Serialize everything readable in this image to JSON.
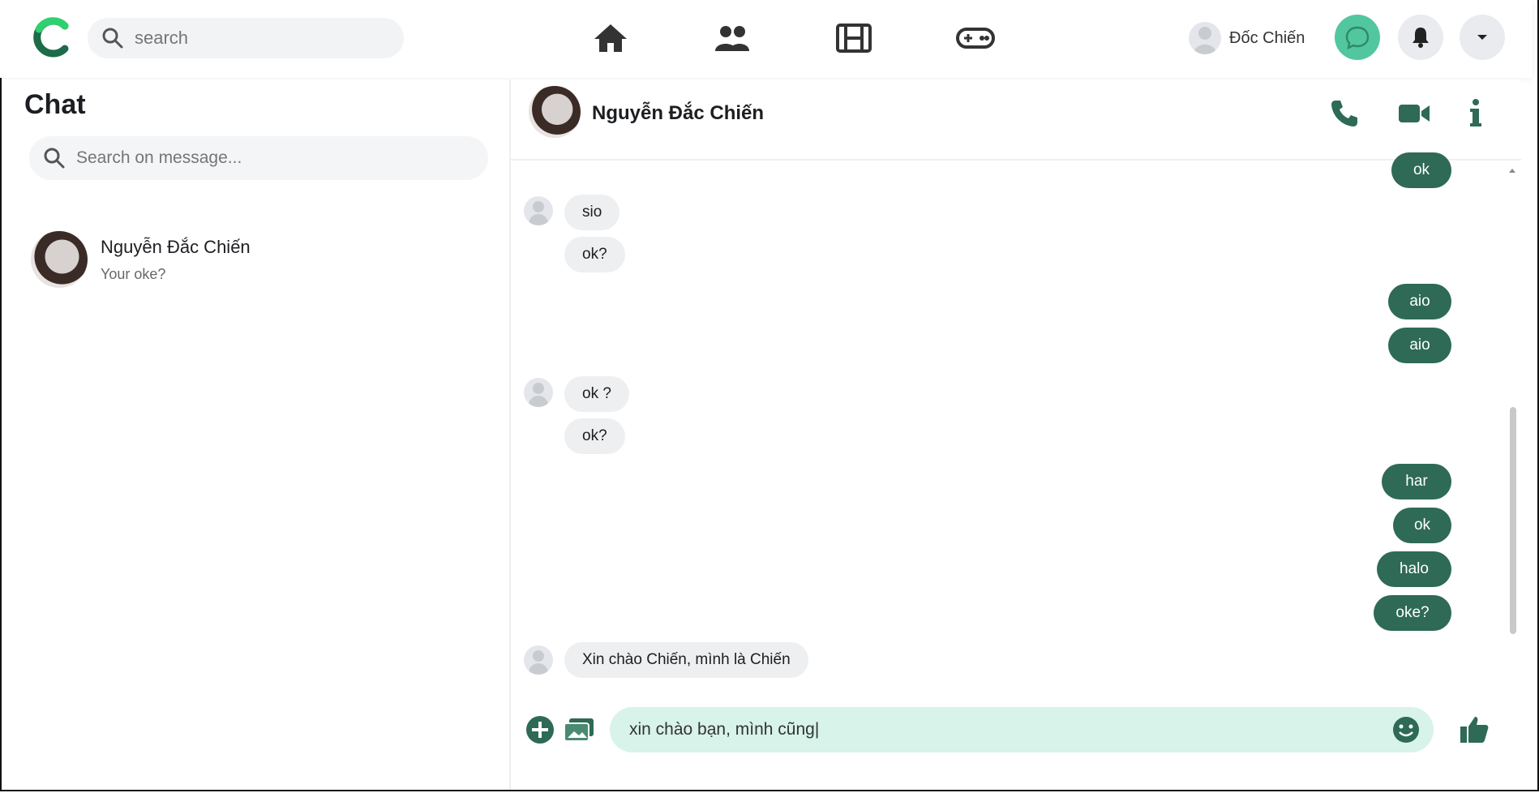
{
  "header": {
    "search_placeholder": "search",
    "nav": [
      "home-icon",
      "friends-icon",
      "video-icon",
      "gaming-icon"
    ],
    "user_name": "Đốc Chiến"
  },
  "sidebar": {
    "title": "Chat",
    "search_placeholder": "Search on message...",
    "conversations": [
      {
        "name": "Nguyễn Đắc Chiến",
        "snippet": "Your oke?"
      }
    ]
  },
  "chat": {
    "contact_name": "Nguyễn Đắc Chiến",
    "messages": [
      {
        "dir": "out",
        "text": "ok"
      },
      {
        "dir": "in",
        "text": "sio"
      },
      {
        "dir": "in",
        "text": "ok?"
      },
      {
        "dir": "out",
        "text": "aio"
      },
      {
        "dir": "out",
        "text": "aio"
      },
      {
        "dir": "in",
        "text": "ok ?"
      },
      {
        "dir": "in",
        "text": "ok?"
      },
      {
        "dir": "out",
        "text": "har"
      },
      {
        "dir": "out",
        "text": "ok"
      },
      {
        "dir": "out",
        "text": "halo"
      },
      {
        "dir": "out",
        "text": "oke?"
      },
      {
        "dir": "in",
        "text": "Xin chào Chiến, mình là Chiến"
      }
    ],
    "composer_value": "xin chào bạn, mình cũng|"
  },
  "colors": {
    "accent": "#2e6a55",
    "accent_light": "#52c79f",
    "input_bg": "#d7f3ea"
  }
}
